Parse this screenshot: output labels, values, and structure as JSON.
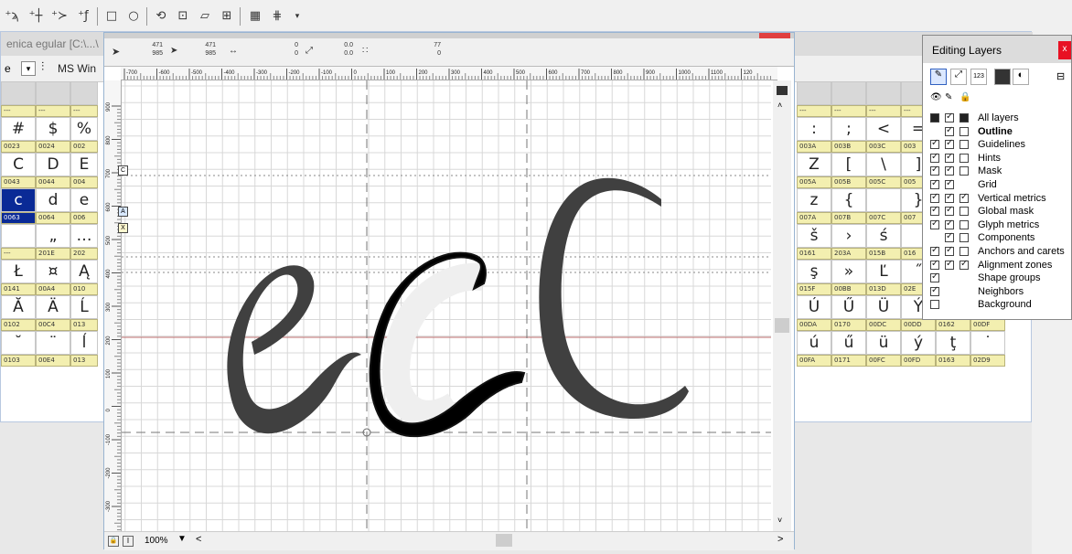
{
  "toolbar": {
    "zoom_label": "100%",
    "icons": [
      "add-curve-point-icon",
      "add-hv-curve-point-icon",
      "add-corner-point-icon",
      "add-tangent-point-icon",
      "rectangle-icon",
      "ellipse-icon",
      "rotate-icon",
      "flip-icon",
      "skew-icon",
      "scale-icon",
      "measure-icon",
      "chart-icon"
    ]
  },
  "font_window": {
    "title": "enica egular [C:\\...\\",
    "font_name": "MS Win",
    "left_headers": [
      [
        "---",
        "---",
        "---"
      ],
      [
        "0023",
        "0024",
        "002"
      ],
      [
        "0043",
        "0044",
        "004"
      ],
      [
        "0063",
        "0064",
        "006"
      ],
      [
        "---",
        "201E",
        "202"
      ],
      [
        "0141",
        "00A4",
        "010"
      ],
      [
        "0102",
        "00C4",
        "013"
      ],
      [
        "0103",
        "00E4",
        "013"
      ]
    ],
    "left_glyphs": [
      [
        "",
        "",
        ""
      ],
      [
        "#",
        "$",
        "%"
      ],
      [
        "C",
        "D",
        "E"
      ],
      [
        "c",
        "d",
        "e"
      ],
      [
        "",
        "„",
        "…"
      ],
      [
        "Ł",
        "¤",
        "Ą"
      ],
      [
        "Ă",
        "Ä",
        "Ĺ"
      ],
      [
        "˘",
        "¨",
        "ĺ"
      ]
    ],
    "right_headers": [
      [
        "---",
        "---",
        "---",
        "---"
      ],
      [
        "003A",
        "003B",
        "003C",
        "003"
      ],
      [
        "005A",
        "005B",
        "005C",
        "005"
      ],
      [
        "007A",
        "007B",
        "007C",
        "007"
      ],
      [
        "0161",
        "203A",
        "015B",
        "016"
      ],
      [
        "015F",
        "00BB",
        "013D",
        "02E",
        "",
        ""
      ],
      [
        "00DA",
        "0170",
        "00DC",
        "00DD",
        "0162",
        "00DF"
      ],
      [
        "00FA",
        "0171",
        "00FC",
        "00FD",
        "0163",
        "02D9"
      ]
    ],
    "right_glyphs": [
      [
        "",
        "",
        "",
        ""
      ],
      [
        ":",
        ";",
        "<",
        "="
      ],
      [
        "Z",
        "[",
        "\\",
        "]"
      ],
      [
        "z",
        "{",
        "",
        "}"
      ],
      [
        "š",
        "›",
        "ś",
        ""
      ],
      [
        "ş",
        "»",
        "Ľ",
        "˝",
        "ľ",
        "ż"
      ],
      [
        "Ú",
        "Ű",
        "Ü",
        "Ý",
        "Ţ",
        "ß"
      ],
      [
        "ú",
        "ű",
        "ü",
        "ý",
        "ţ",
        "˙"
      ]
    ]
  },
  "glyph_window": {
    "coords": {
      "x1": "471",
      "y1": "985",
      "x2": "471",
      "y2": "985",
      "w": "0",
      "h": "0",
      "len": "0.0",
      "angle": "0.0",
      "v1": "77",
      "v2": "0"
    },
    "ruler_h_ticks": [
      "-700",
      "-600",
      "-500",
      "-400",
      "-300",
      "-200",
      "-100",
      "0",
      "100",
      "200",
      "300",
      "400",
      "500",
      "600",
      "700",
      "800",
      "900",
      "1000",
      "1100",
      "120"
    ],
    "ruler_v_ticks": [
      "900",
      "800",
      "700",
      "600",
      "500",
      "400",
      "300",
      "200",
      "100",
      "0",
      "-100",
      "-200",
      "-300",
      "-400"
    ],
    "zone_markers": [
      "C",
      "A",
      "X"
    ],
    "zoom": "100%"
  },
  "layers_panel": {
    "title": "Editing Layers",
    "close": "x",
    "items": [
      {
        "name": "All layers",
        "vis": "fill",
        "edit": "on",
        "lock": "fill"
      },
      {
        "name": "Outline",
        "vis": "none",
        "edit": "on",
        "lock": "off",
        "bold": true
      },
      {
        "name": "Guidelines",
        "vis": "on",
        "edit": "on",
        "lock": "off"
      },
      {
        "name": "Hints",
        "vis": "on",
        "edit": "on",
        "lock": "off"
      },
      {
        "name": "Mask",
        "vis": "on",
        "edit": "on",
        "lock": "off"
      },
      {
        "name": "Grid",
        "vis": "on",
        "edit": "on",
        "lock": "none"
      },
      {
        "name": "Vertical metrics",
        "vis": "on",
        "edit": "on",
        "lock": "on"
      },
      {
        "name": "Global mask",
        "vis": "on",
        "edit": "on",
        "lock": "off"
      },
      {
        "name": "Glyph metrics",
        "vis": "on",
        "edit": "on",
        "lock": "off"
      },
      {
        "name": "Components",
        "vis": "none",
        "edit": "on",
        "lock": "off"
      },
      {
        "name": "Anchors and carets",
        "vis": "on",
        "edit": "on",
        "lock": "off"
      },
      {
        "name": "Alignment zones",
        "vis": "on",
        "edit": "on",
        "lock": "on"
      },
      {
        "name": "Shape groups",
        "vis": "on",
        "edit": "none",
        "lock": "none"
      },
      {
        "name": "Neighbors",
        "vis": "on",
        "edit": "none",
        "lock": "none"
      },
      {
        "name": "Background",
        "vis": "off",
        "edit": "none",
        "lock": "none"
      }
    ]
  },
  "colors": {
    "selection": "#0a2a96",
    "header": "#f3efb0",
    "glyph": "#3d3d3d"
  }
}
